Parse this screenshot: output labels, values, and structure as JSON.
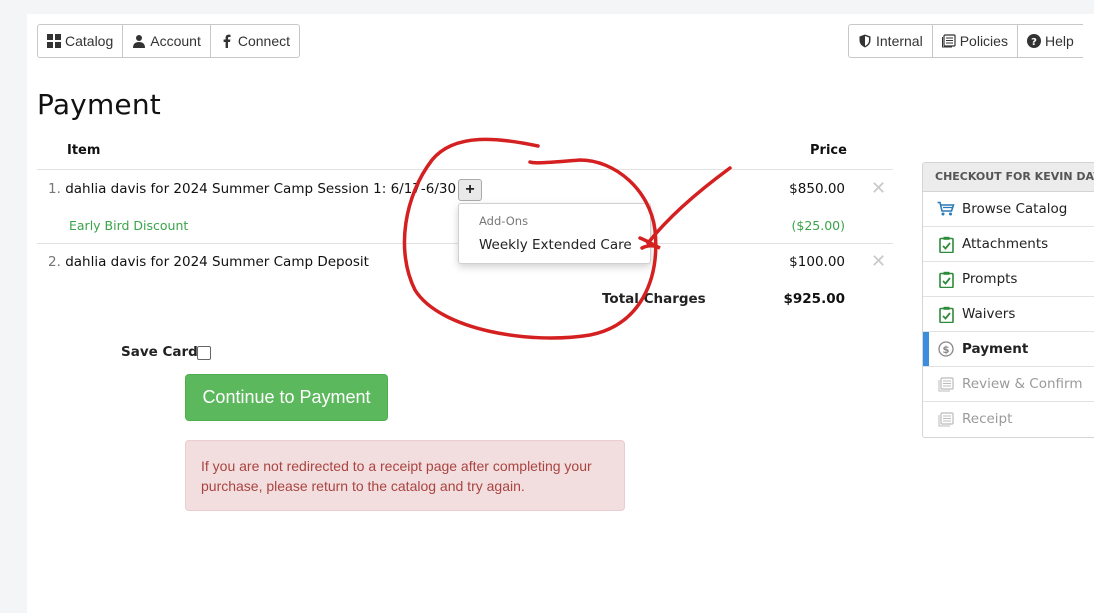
{
  "top_nav": {
    "catalog": "Catalog",
    "account": "Account",
    "connect": "Connect",
    "internal": "Internal",
    "policies": "Policies",
    "help": "Help"
  },
  "page_title": "Payment",
  "table": {
    "col_item": "Item",
    "col_price": "Price",
    "rows": [
      {
        "num": "1.",
        "name": "dahlia davis for 2024 Summer Camp Session 1: 6/17-6/30",
        "price": "$850.00",
        "discount_label": "Early Bird Discount",
        "discount_value": "($25.00)"
      },
      {
        "num": "2.",
        "name": "dahlia davis for 2024 Summer Camp Deposit",
        "price": "$100.00"
      }
    ],
    "total_label": "Total Charges",
    "total_value": "$925.00"
  },
  "addons_dropdown": {
    "header": "Add-Ons",
    "item": "Weekly Extended Care"
  },
  "save_card_label": "Save Card",
  "continue_button": "Continue to Payment",
  "alert_text": "If you are not redirected to a receipt page after completing your purchase, please return to the catalog and try again.",
  "sidebar": {
    "header": "CHECKOUT FOR KEVIN DAVIS",
    "items": [
      {
        "label": "Browse Catalog",
        "icon": "cart-icon",
        "state": "done"
      },
      {
        "label": "Attachments",
        "icon": "clipboard-check-icon",
        "state": "done"
      },
      {
        "label": "Prompts",
        "icon": "clipboard-check-icon",
        "state": "done"
      },
      {
        "label": "Waivers",
        "icon": "clipboard-check-icon",
        "state": "done"
      },
      {
        "label": "Payment",
        "icon": "dollar-circle-icon",
        "state": "active"
      },
      {
        "label": "Review & Confirm",
        "icon": "receipt-icon",
        "state": "disabled"
      },
      {
        "label": "Receipt",
        "icon": "receipt-icon",
        "state": "disabled"
      }
    ]
  },
  "colors": {
    "success_green": "#5cb85c",
    "discount_green": "#3aa44a",
    "alert_bg": "#f2dede",
    "alert_text": "#a94442",
    "active_bar": "#3c8dde",
    "annotation_red": "#d42020"
  }
}
